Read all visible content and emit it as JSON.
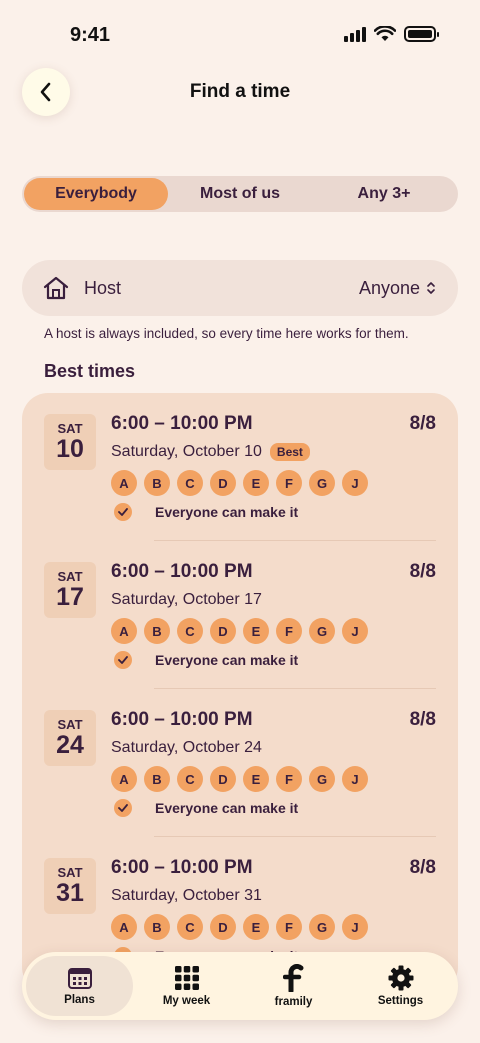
{
  "status": {
    "time": "9:41"
  },
  "header": {
    "title": "Find a time"
  },
  "segments": [
    {
      "label": "Everybody",
      "active": true
    },
    {
      "label": "Most of us",
      "active": false
    },
    {
      "label": "Any 3+",
      "active": false
    }
  ],
  "host": {
    "label": "Host",
    "value": "Anyone",
    "note": "A host is always included, so every time here works for them."
  },
  "best_times": {
    "title": "Best times",
    "items": [
      {
        "dow": "SAT",
        "day": "10",
        "range": "6:00 – 10:00 PM",
        "count": "8/8",
        "date": "Saturday, October 10",
        "badge": "Best",
        "avatars": [
          "A",
          "B",
          "C",
          "D",
          "E",
          "F",
          "G",
          "J"
        ],
        "status": "Everyone can make it"
      },
      {
        "dow": "SAT",
        "day": "17",
        "range": "6:00 – 10:00 PM",
        "count": "8/8",
        "date": "Saturday, October 17",
        "badge": "",
        "avatars": [
          "A",
          "B",
          "C",
          "D",
          "E",
          "F",
          "G",
          "J"
        ],
        "status": "Everyone can make it"
      },
      {
        "dow": "SAT",
        "day": "24",
        "range": "6:00 – 10:00 PM",
        "count": "8/8",
        "date": "Saturday, October 24",
        "badge": "",
        "avatars": [
          "A",
          "B",
          "C",
          "D",
          "E",
          "F",
          "G",
          "J"
        ],
        "status": "Everyone can make it"
      },
      {
        "dow": "SAT",
        "day": "31",
        "range": "6:00 – 10:00 PM",
        "count": "8/8",
        "date": "Saturday, October 31",
        "badge": "",
        "avatars": [
          "A",
          "B",
          "C",
          "D",
          "E",
          "F",
          "G",
          "J"
        ],
        "status": "Everyone can make it"
      }
    ]
  },
  "tabs": [
    {
      "label": "Plans",
      "icon": "calendar-icon",
      "active": true
    },
    {
      "label": "My week",
      "icon": "grid-icon",
      "active": false
    },
    {
      "label": "framily",
      "icon": "framily-logo-icon",
      "active": false
    },
    {
      "label": "Settings",
      "icon": "gear-icon",
      "active": false
    }
  ],
  "colors": {
    "accent": "#f2a262",
    "text": "#3a1f3d",
    "background": "#fbf1ea",
    "card": "#f4dccb"
  }
}
